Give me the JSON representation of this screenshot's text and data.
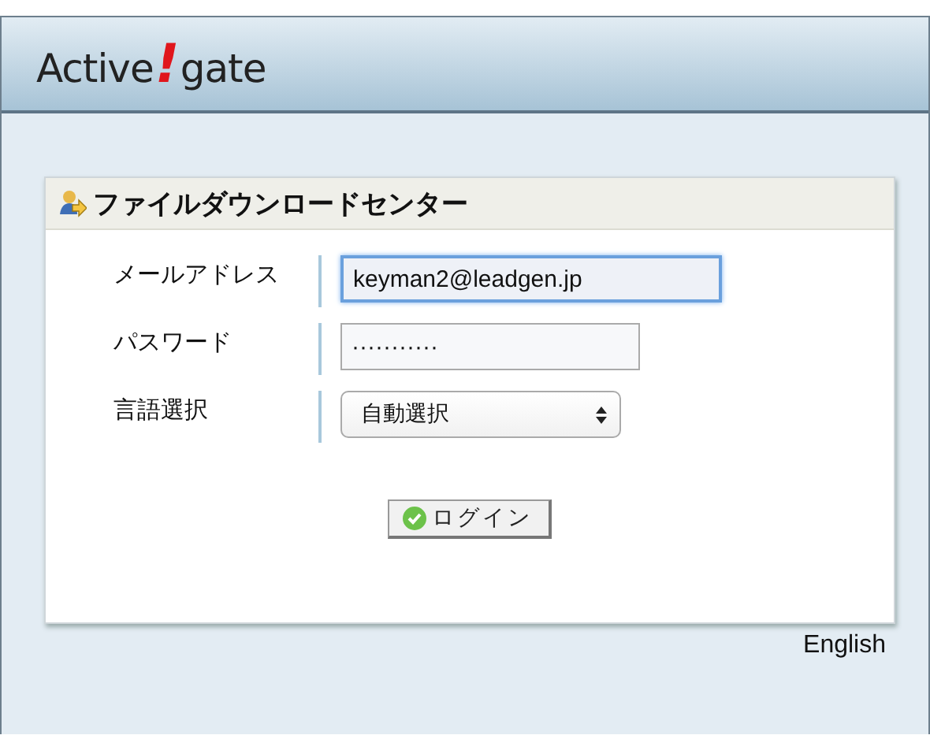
{
  "logo": {
    "before": "Active",
    "mark": "!",
    "after": "gate"
  },
  "panel": {
    "title": "ファイルダウンロードセンター"
  },
  "fields": [
    {
      "kind": "text",
      "label": "メールアドレス",
      "value": "keyman2@leadgen.jp",
      "focused": true
    },
    {
      "kind": "text",
      "label": "パスワード",
      "value": "···········",
      "focused": false
    },
    {
      "kind": "select",
      "label": "言語選択",
      "value": "自動選択",
      "focused": false
    }
  ],
  "login_button": "ログイン",
  "language_link": "English"
}
